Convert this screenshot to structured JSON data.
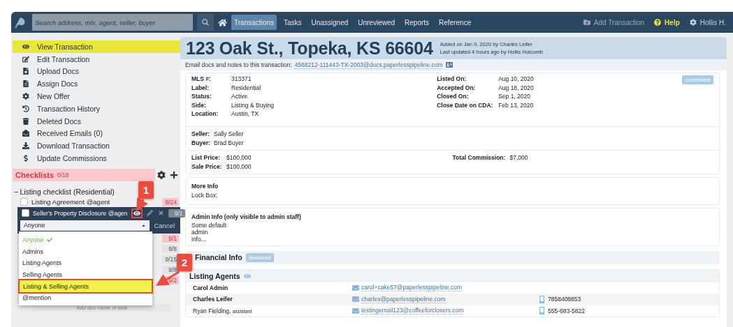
{
  "nav": {
    "search": {
      "placeholder": "Search address, mls, agent, seller, buyer"
    },
    "tabs": [
      {
        "label": "Transactions",
        "selected": true
      },
      {
        "label": "Tasks",
        "selected": false
      },
      {
        "label": "Unassigned",
        "selected": false
      },
      {
        "label": "Unreviewed",
        "selected": false
      },
      {
        "label": "Reports",
        "selected": false
      },
      {
        "label": "Reference",
        "selected": false
      }
    ],
    "actions": [
      {
        "kind": "add",
        "label": "Add Transaction"
      },
      {
        "kind": "help",
        "label": "Help"
      },
      {
        "kind": "user",
        "label": "Hollis H."
      }
    ]
  },
  "sidebar": {
    "items": [
      {
        "kind": "view",
        "label": "View Transaction",
        "selected": true
      },
      {
        "kind": "edit",
        "label": "Edit Transaction",
        "selected": false
      },
      {
        "kind": "upload",
        "label": "Upload Docs",
        "selected": false
      },
      {
        "kind": "assign",
        "label": "Assign Docs",
        "selected": false
      },
      {
        "kind": "offer",
        "label": "New Offer",
        "selected": false
      },
      {
        "kind": "history",
        "label": "Transaction History",
        "selected": false
      },
      {
        "kind": "deleted",
        "label": "Deleted Docs",
        "selected": false
      },
      {
        "kind": "emails",
        "label": "Received Emails (0)",
        "selected": false
      },
      {
        "kind": "download",
        "label": "Download Transaction",
        "selected": false
      },
      {
        "kind": "commissions",
        "label": "Update Commissions",
        "selected": false
      }
    ],
    "checklists": {
      "title": "Checklists",
      "count": "0/18",
      "group": {
        "expander": "−",
        "title": "Listing checklist (Residential)",
        "items": [
          {
            "label": "Listing Agreement @agent",
            "due": "8/24",
            "overdue": true,
            "checked": false,
            "editing": false
          },
          {
            "label": "Seller's Property Disclosure @agen",
            "due": "9/1",
            "overdue": false,
            "checked": false,
            "editing": true
          },
          {
            "due": "9/1",
            "overdue": true
          },
          {
            "due": "9/8",
            "overdue": false
          },
          {
            "due": "9/15",
            "overdue": false
          },
          {
            "due": "9/8",
            "overdue": false
          },
          {
            "due": "9/2",
            "overdue": true
          }
        ],
        "add_placeholder": "Add doc name or task"
      },
      "visibility": {
        "value": "Anyone",
        "cancel": "Cancel",
        "options": [
          {
            "label": "Anyone",
            "selected": true,
            "highlighted": false
          },
          {
            "label": "Admins",
            "selected": false,
            "highlighted": false
          },
          {
            "label": "Listing Agents",
            "selected": false,
            "highlighted": false
          },
          {
            "label": "Selling Agents",
            "selected": false,
            "highlighted": false
          },
          {
            "label": "Listing & Selling Agents",
            "selected": false,
            "highlighted": true
          },
          {
            "label": "@mention",
            "selected": false,
            "highlighted": false
          }
        ]
      }
    }
  },
  "annotations": [
    {
      "number": "1"
    },
    {
      "number": "2"
    }
  ],
  "transaction": {
    "title": "123 Oak St., Topeka, KS 66604",
    "added": "Added on Jan 9, 2020 by Charles Leifer",
    "updated": "Last updated 4 hours ago by Hollis Holcomb",
    "email": {
      "label": "Email docs and notes to this transaction:",
      "address": "4568212-111443-TX-2003@docs.paperlesspipeline.com"
    },
    "coversheet": "coversheet",
    "details_left": [
      {
        "label": "MLS #:",
        "value": "313371"
      },
      {
        "label": "Label:",
        "value": "Residential"
      },
      {
        "label": "Status:",
        "value": "Active"
      },
      {
        "label": "Side:",
        "value": "Listing & Buying"
      },
      {
        "label": "Location:",
        "value": "Austin, TX"
      }
    ],
    "details_right": [
      {
        "label": "Listed On:",
        "value": "Aug 10, 2020"
      },
      {
        "label": "Accepted On:",
        "value": "Aug 18, 2020"
      },
      {
        "label": "Closed On:",
        "value": "Sep 1, 2020"
      },
      {
        "label": "Close Date on CDA:",
        "value": "Feb 13, 2020"
      }
    ],
    "parties": [
      {
        "label": "Seller:",
        "value": "Sally Seller"
      },
      {
        "label": "Buyer:",
        "value": "Brad Buyer"
      }
    ],
    "prices": [
      {
        "label": "List Price:",
        "value": "$100,000"
      },
      {
        "label": "Sale Price:",
        "value": "$100,000"
      }
    ],
    "commission": {
      "label": "Total Commission:",
      "value": "$7,000"
    },
    "more_info": {
      "title": "More Info",
      "lines": [
        "Lock Box:"
      ]
    },
    "admin_info": {
      "title": "Admin Info (only visible to admin staff)",
      "lines": [
        "Some default",
        "admin",
        "info..."
      ]
    },
    "financial": {
      "title": "Financial Info",
      "button": "download"
    },
    "listing_agents": {
      "title": "Listing Agents",
      "rows": [
        {
          "name": "Carol Admin",
          "agent": true,
          "email": "carol+cake57@paperlesspipeline.com"
        },
        {
          "name": "Charles Leifer",
          "agent": true,
          "email": "charles@paperlesspipeline.com",
          "phone": "7858408853"
        },
        {
          "name": "Ryan Fielding,",
          "role": "assistant",
          "agent": false,
          "email": "testingemail123@coffeeforclosers.com",
          "phone": "555-683-5822"
        }
      ]
    }
  }
}
